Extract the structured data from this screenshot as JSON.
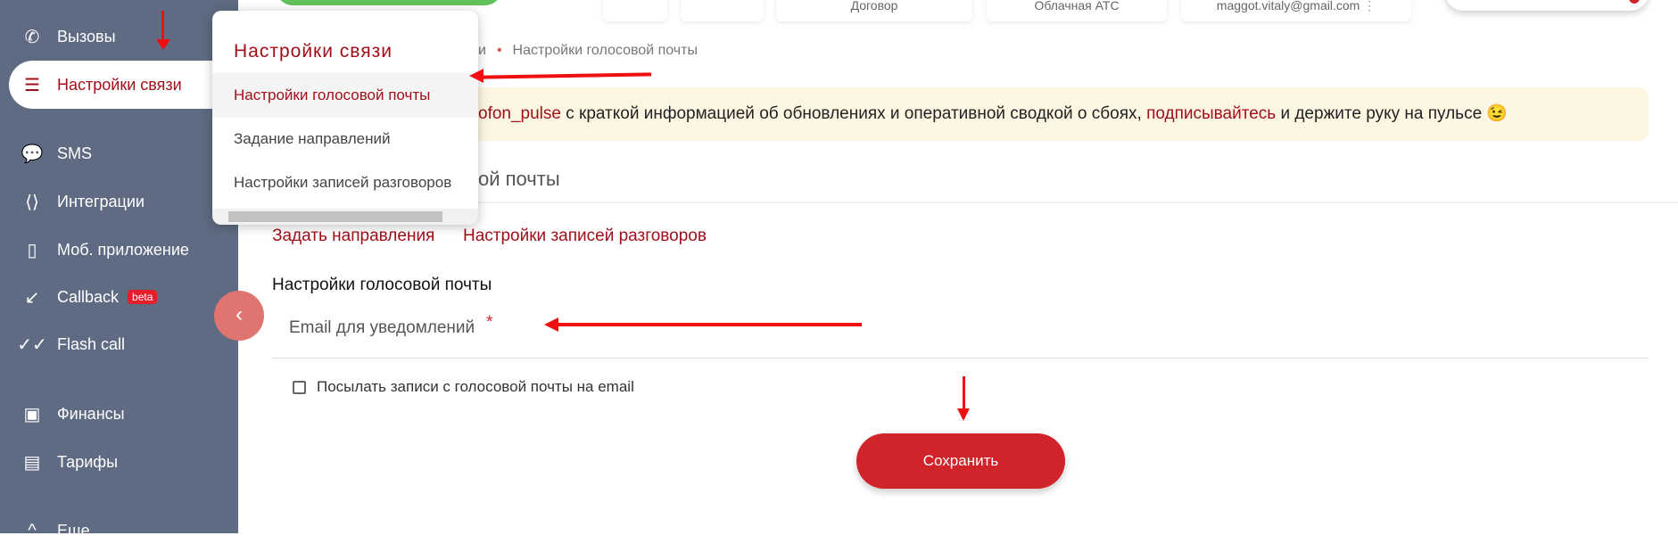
{
  "sidebar": {
    "items": [
      {
        "label": "Вызовы",
        "icon": "phone-icon"
      },
      {
        "label": "Настройки связи",
        "icon": "sliders-icon",
        "active": true
      },
      {
        "label": "SMS",
        "icon": "chat-icon"
      },
      {
        "label": "Интеграции",
        "icon": "code-icon"
      },
      {
        "label": "Моб. приложение",
        "icon": "mobile-icon"
      },
      {
        "label": "Callback",
        "icon": "callback-icon",
        "badge": "beta"
      },
      {
        "label": "Flash call",
        "icon": "double-check-icon"
      },
      {
        "label": "Финансы",
        "icon": "wallet-icon"
      },
      {
        "label": "Тарифы",
        "icon": "tariff-icon"
      },
      {
        "label": "Еще",
        "icon": "chevron-up-icon"
      }
    ]
  },
  "popup": {
    "title": "Настройки связи",
    "items": [
      "Настройки голосовой почты",
      "Задание направлений",
      "Настройки записей разговоров"
    ]
  },
  "header": {
    "cards": [
      "Договор",
      "Облачная АТС",
      "maggot.vitaly@gmail.com"
    ]
  },
  "breadcrumb": {
    "partial": "и",
    "current": "Настройки голосовой почты"
  },
  "banner": {
    "link1": "ofon_pulse",
    "text1": " с краткой информацией об обновлениях и оперативной сводкой о сбоях, ",
    "link2": "подписывайтесь",
    "text2": " и держите руку на пульсе ",
    "emoji": "😉"
  },
  "main": {
    "heading": "ой почты",
    "links": [
      "Задать направления",
      "Настройки записей разговоров"
    ],
    "section_title": "Настройки голосовой почты",
    "email_label": "Email для уведомлений",
    "required_mark": "*",
    "checkbox_label": "Посылать записи с голосовой почты на email",
    "save_label": "Сохранить"
  },
  "colors": {
    "sidebar": "#5f6b82",
    "accent": "#a0101b",
    "button": "#d0232a",
    "banner": "#fcf6e2"
  }
}
